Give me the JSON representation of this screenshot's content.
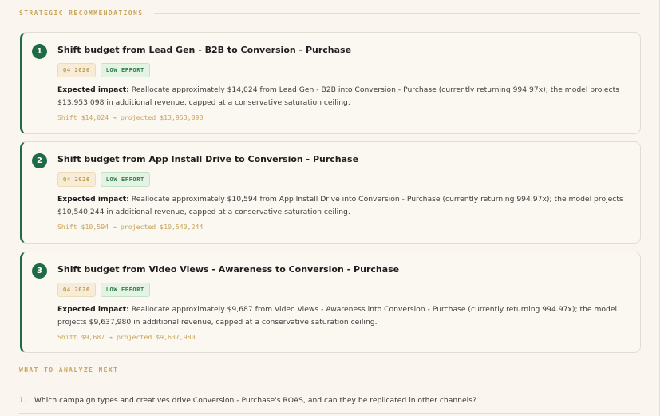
{
  "sections": {
    "recommendations_title": "STRATEGIC RECOMMENDATIONS",
    "next_title": "WHAT TO ANALYZE NEXT"
  },
  "recommendations": [
    {
      "number": "1",
      "title": "Shift budget from Lead Gen - B2B to Conversion - Purchase",
      "quarter": "Q4 2026",
      "effort": "LOW EFFORT",
      "impact_label": "Expected impact:",
      "impact_text": "Reallocate approximately $14,024 from Lead Gen - B2B into Conversion - Purchase (currently returning 994.97x); the model projects $13,953,098 in additional revenue, capped at a conservative saturation ceiling.",
      "shift": "Shift $14,024 → projected $13,953,098"
    },
    {
      "number": "2",
      "title": "Shift budget from App Install Drive to Conversion - Purchase",
      "quarter": "Q4 2026",
      "effort": "LOW EFFORT",
      "impact_label": "Expected impact:",
      "impact_text": "Reallocate approximately $10,594 from App Install Drive into Conversion - Purchase (currently returning 994.97x); the model projects $10,540,244 in additional revenue, capped at a conservative saturation ceiling.",
      "shift": "Shift $10,594 → projected $10,540,244"
    },
    {
      "number": "3",
      "title": "Shift budget from Video Views - Awareness to Conversion - Purchase",
      "quarter": "Q4 2026",
      "effort": "LOW EFFORT",
      "impact_label": "Expected impact:",
      "impact_text": "Reallocate approximately $9,687 from Video Views - Awareness into Conversion - Purchase (currently returning 994.97x); the model projects $9,637,980 in additional revenue, capped at a conservative saturation ceiling.",
      "shift": "Shift $9,687 → projected $9,637,980"
    }
  ],
  "next": [
    {
      "number": "1.",
      "text": "Which campaign types and creatives drive Conversion - Purchase's ROAS, and can they be replicated in other channels?"
    }
  ],
  "colors": {
    "accent_green": "#1f6b45",
    "accent_gold": "#c8a45a",
    "background": "#faf6ef"
  }
}
